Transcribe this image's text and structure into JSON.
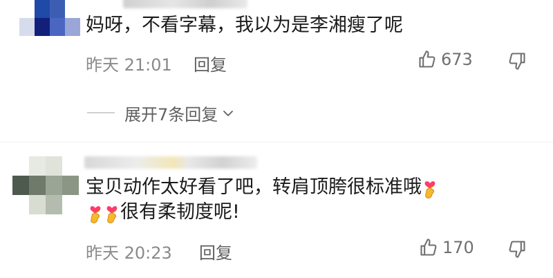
{
  "comments": [
    {
      "text": "妈呀，不看字幕，我以为是李湘瘦了呢",
      "time": "昨天 21:01",
      "reply_label": "回复",
      "like_count": "673"
    },
    {
      "text_line1": "宝贝动作太好看了吧，转肩顶胯很标准哦",
      "text_line2": "很有柔韧度呢!",
      "time": "昨天 20:23",
      "reply_label": "回复",
      "like_count": "170"
    }
  ],
  "expand_replies_label": "展开7条回复",
  "colors": {
    "secondary_text": "#8a8a8a",
    "emoji_heart": "#ff3b6b",
    "emoji_hand": "#f5b82e"
  }
}
